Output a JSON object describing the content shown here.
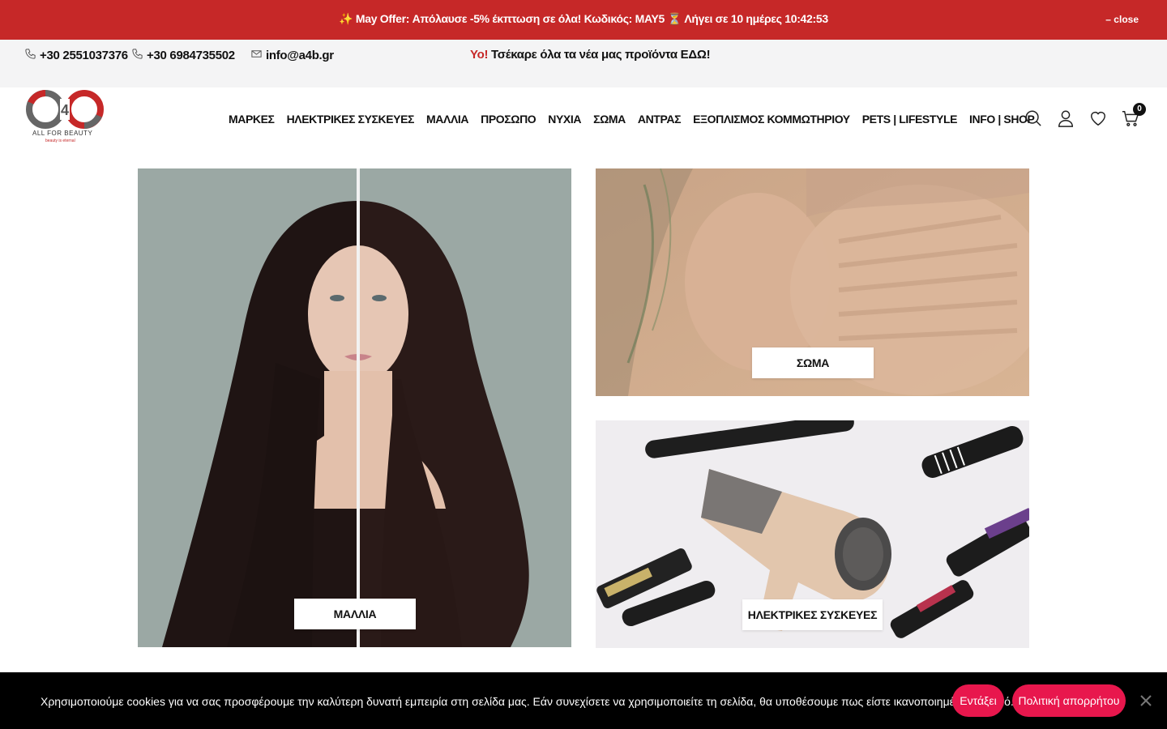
{
  "promo": {
    "message": "✨ May Offer: Απόλαυσε -5% έκπτωση σε όλα! Κωδικός: MAY5 ⏳ Λήγει σε 10 ημέρες 10:42:53",
    "close_label": "– close"
  },
  "contact": {
    "phone1": "+30 2551037376",
    "phone2": "+30 6984735502",
    "email": "info@a4b.gr",
    "news_highlight": "Yo!",
    "news_text": "Τσέκαρε όλα τα νέα μας προϊόντα ΕΔΩ!"
  },
  "logo": {
    "digit": "4",
    "tagline": "ALL FOR BEAUTY",
    "subtagline": "beauty is eternal"
  },
  "nav": {
    "items": [
      "ΜΑΡΚΕΣ",
      "ΗΛΕΚΤΡΙΚΕΣ ΣΥΣΚΕΥΕΣ",
      "ΜΑΛΛΙΑ",
      "ΠΡΟΣΩΠΟ",
      "ΝΥΧΙΑ",
      "ΣΩΜΑ",
      "ΑΝΤΡΑΣ",
      "ΕΞΟΠΛΙΣΜΟΣ ΚΟΜΜΩΤΗΡΙΟΥ",
      "PETS | LIFESTYLE",
      "INFO | SHOP"
    ]
  },
  "header_icons": {
    "cart_count": "0"
  },
  "tiles": {
    "hair_label": "ΜΑΛΛΙΑ",
    "body_label": "ΣΩΜΑ",
    "electric_label": "ΗΛΕΚΤΡΙΚΕΣ ΣΥΣΚΕΥΕΣ"
  },
  "cookie": {
    "text": "Χρησιμοποιούμε cookies για να σας προσφέρουμε την καλύτερη δυνατή εμπειρία στη σελίδα μας. Εάν συνεχίσετε να χρησιμοποιείτε τη σελίδα, θα υποθέσουμε πως είστε ικανοποιημένοι με αυτό.",
    "accept_label": "Εντάξει",
    "policy_label": "Πολιτική απορρήτου"
  },
  "colors": {
    "promo_bg": "#c62828",
    "cookie_button": "#e8174d",
    "accent_red": "#c62828"
  }
}
